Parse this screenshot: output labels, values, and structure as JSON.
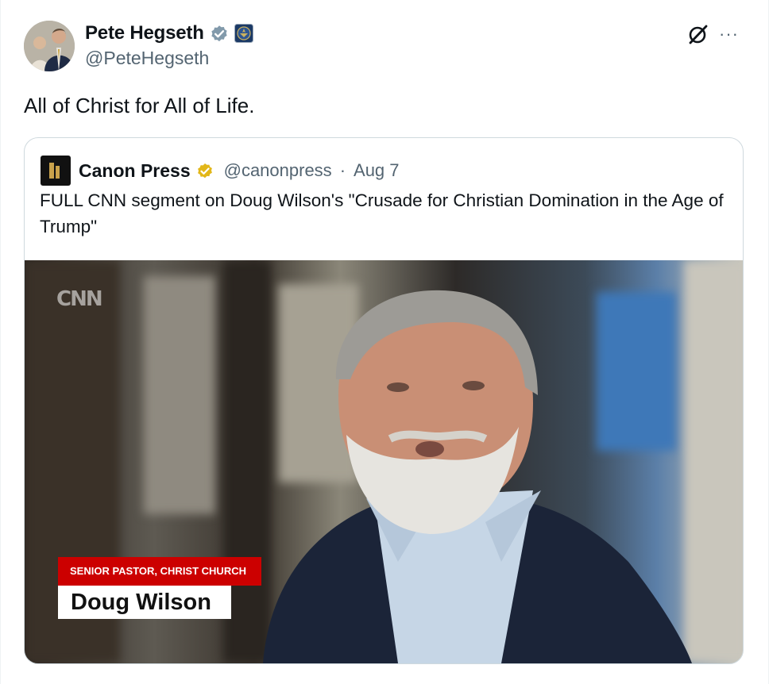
{
  "author": {
    "display_name": "Pete Hegseth",
    "handle": "@PeteHegseth",
    "verified_color": "#829aab"
  },
  "tweet": {
    "text": "All of Christ for All of Life."
  },
  "actions": {
    "grok_icon": "grok-icon",
    "more_label": "···"
  },
  "quote": {
    "display_name": "Canon Press",
    "handle": "@canonpress",
    "separator": "·",
    "date": "Aug 7",
    "verified_color": "#e2b719",
    "text": "FULL CNN segment on Doug Wilson's \"Crusade for Christian Domination in the Age of Trump\"",
    "video": {
      "network_logo": "CNN",
      "chyron_title": "SENIOR PASTOR, CHRIST CHURCH",
      "chyron_name": "Doug Wilson",
      "chyron_color": "#cc0000"
    }
  }
}
